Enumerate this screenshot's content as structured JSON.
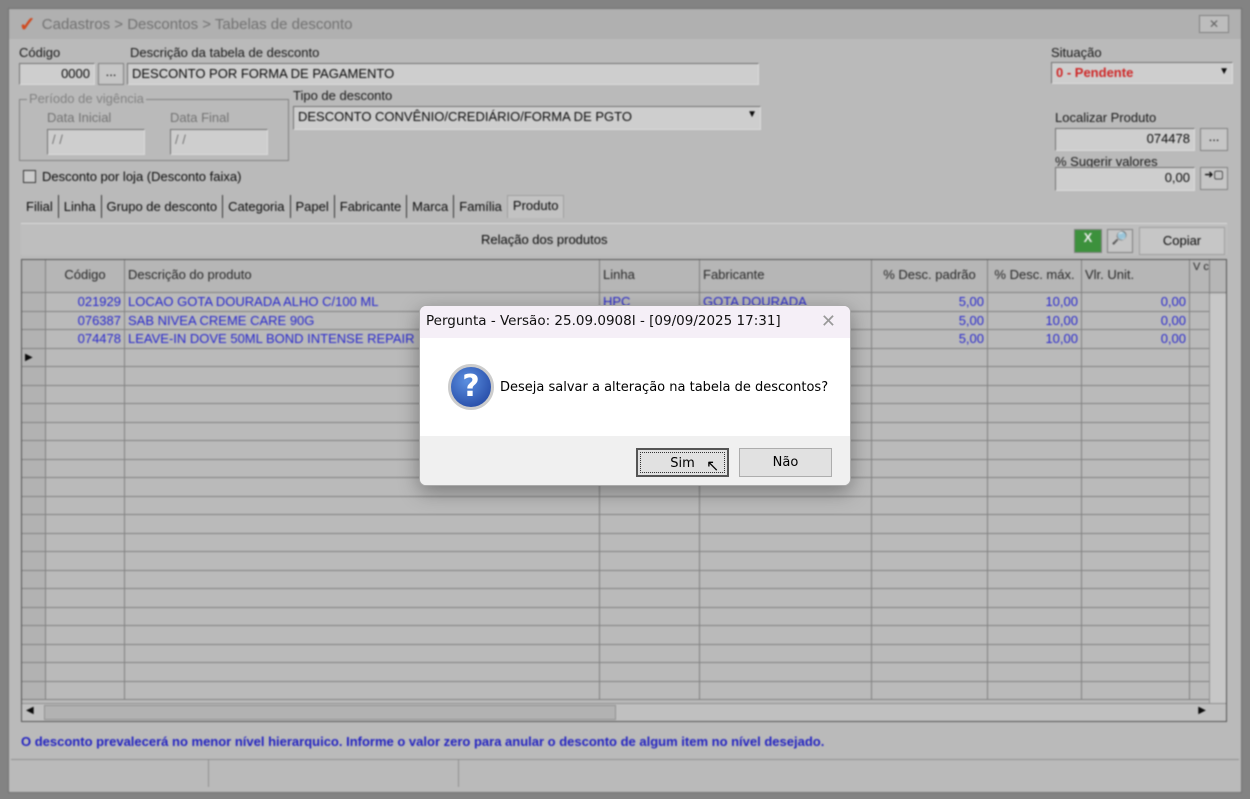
{
  "window": {
    "title": "Cadastros > Descontos > Tabelas de desconto",
    "close": "✕"
  },
  "form": {
    "codigo_label": "Código",
    "codigo_value": "0000",
    "lookup": "...",
    "descricao_label": "Descrição da tabela de desconto",
    "descricao_value": "DESCONTO POR FORMA DE PAGAMENTO",
    "periodo_label": "Período de vigência",
    "data_inicial_label": "Data Inicial",
    "data_inicial_value": "/ /",
    "data_final_label": "Data Final",
    "data_final_value": "/ /",
    "tipo_label": "Tipo de desconto",
    "tipo_value": "DESCONTO CONVÊNIO/CREDIÁRIO/FORMA DE PGTO",
    "situacao_label": "Situação",
    "situacao_value": "0 - Pendente",
    "localizar_label": "Localizar Produto",
    "localizar_value": "074478",
    "sugerir_label": "% Sugerir valores",
    "sugerir_value": "0,00",
    "checkbox_label": "Desconto por loja (Desconto faixa)"
  },
  "tabs": [
    "Filial",
    "Linha",
    "Grupo de desconto",
    "Categoria",
    "Papel",
    "Fabricante",
    "Marca",
    "Família",
    "Produto"
  ],
  "panel": {
    "title": "Relação dos produtos",
    "copy": "Copiar"
  },
  "table": {
    "headers": [
      "Código",
      "Descrição do produto",
      "Linha",
      "Fabricante",
      "% Desc. padrão",
      "% Desc. máx.",
      "Vlr. Unit.",
      "V cu"
    ],
    "rows": [
      [
        "021929",
        "LOCAO GOTA DOURADA ALHO C/100 ML",
        "HPC",
        "GOTA DOURADA",
        "5,00",
        "10,00",
        "0,00"
      ],
      [
        "076387",
        "SAB NIVEA CREME CARE 90G",
        "",
        "",
        "5,00",
        "10,00",
        "0,00"
      ],
      [
        "074478",
        "LEAVE-IN DOVE 50ML BOND INTENSE REPAIR",
        "",
        "",
        "5,00",
        "10,00",
        "0,00"
      ]
    ]
  },
  "footer_note": "O desconto prevalecerá no menor nível hierarquico. Informe o valor zero para anular o desconto de algum item no nível desejado.",
  "dialog": {
    "title": "Pergunta - Versão: 25.09.0908I - [09/09/2025 17:31]",
    "message": "Deseja salvar a alteração na tabela de descontos?",
    "yes": "Sim",
    "no": "Não"
  },
  "colors": {
    "situacao": "#e02020",
    "link": "#2222dd"
  }
}
